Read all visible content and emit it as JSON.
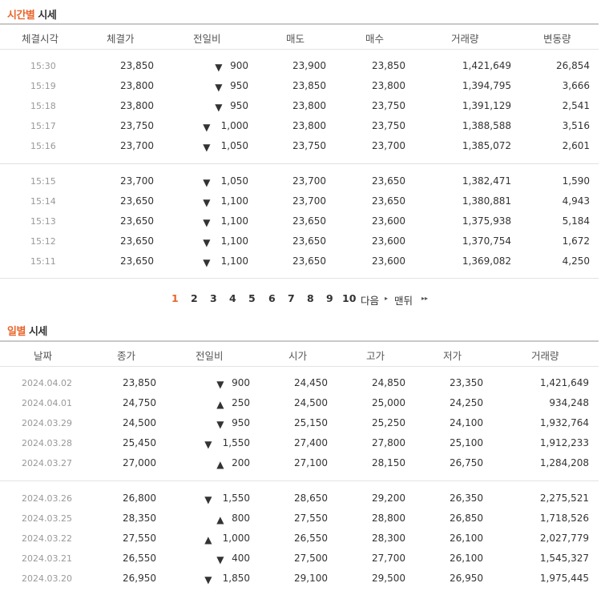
{
  "time_section": {
    "title_accent": "시간별",
    "title_rest": " 시세",
    "headers": [
      "체결시각",
      "체결가",
      "전일비",
      "매도",
      "매수",
      "거래량",
      "변동량"
    ],
    "groups": [
      [
        {
          "time": "15:30",
          "price": "23,850",
          "dir": "down",
          "change": "900",
          "sell": "23,900",
          "buy": "23,850",
          "volume": "1,421,649",
          "delta": "26,854"
        },
        {
          "time": "15:19",
          "price": "23,800",
          "dir": "down",
          "change": "950",
          "sell": "23,850",
          "buy": "23,800",
          "volume": "1,394,795",
          "delta": "3,666"
        },
        {
          "time": "15:18",
          "price": "23,800",
          "dir": "down",
          "change": "950",
          "sell": "23,800",
          "buy": "23,750",
          "volume": "1,391,129",
          "delta": "2,541"
        },
        {
          "time": "15:17",
          "price": "23,750",
          "dir": "down",
          "change": "1,000",
          "sell": "23,800",
          "buy": "23,750",
          "volume": "1,388,588",
          "delta": "3,516"
        },
        {
          "time": "15:16",
          "price": "23,700",
          "dir": "down",
          "change": "1,050",
          "sell": "23,750",
          "buy": "23,700",
          "volume": "1,385,072",
          "delta": "2,601"
        }
      ],
      [
        {
          "time": "15:15",
          "price": "23,700",
          "dir": "down",
          "change": "1,050",
          "sell": "23,700",
          "buy": "23,650",
          "volume": "1,382,471",
          "delta": "1,590"
        },
        {
          "time": "15:14",
          "price": "23,650",
          "dir": "down",
          "change": "1,100",
          "sell": "23,700",
          "buy": "23,650",
          "volume": "1,380,881",
          "delta": "4,943"
        },
        {
          "time": "15:13",
          "price": "23,650",
          "dir": "down",
          "change": "1,100",
          "sell": "23,650",
          "buy": "23,600",
          "volume": "1,375,938",
          "delta": "5,184"
        },
        {
          "time": "15:12",
          "price": "23,650",
          "dir": "down",
          "change": "1,100",
          "sell": "23,650",
          "buy": "23,600",
          "volume": "1,370,754",
          "delta": "1,672"
        },
        {
          "time": "15:11",
          "price": "23,650",
          "dir": "down",
          "change": "1,100",
          "sell": "23,650",
          "buy": "23,600",
          "volume": "1,369,082",
          "delta": "4,250"
        }
      ]
    ]
  },
  "pagination": {
    "pages": [
      "1",
      "2",
      "3",
      "4",
      "5",
      "6",
      "7",
      "8",
      "9",
      "10"
    ],
    "current": "1",
    "next_label": "다음",
    "last_label": "맨뒤"
  },
  "daily_section": {
    "title_accent": "일별",
    "title_rest": " 시세",
    "headers": [
      "날짜",
      "종가",
      "전일비",
      "시가",
      "고가",
      "저가",
      "거래량"
    ],
    "groups": [
      [
        {
          "date": "2024.04.02",
          "close": "23,850",
          "dir": "down",
          "change": "900",
          "open": "24,450",
          "high": "24,850",
          "low": "23,350",
          "volume": "1,421,649"
        },
        {
          "date": "2024.04.01",
          "close": "24,750",
          "dir": "up",
          "change": "250",
          "open": "24,500",
          "high": "25,000",
          "low": "24,250",
          "volume": "934,248"
        },
        {
          "date": "2024.03.29",
          "close": "24,500",
          "dir": "down",
          "change": "950",
          "open": "25,150",
          "high": "25,250",
          "low": "24,100",
          "volume": "1,932,764"
        },
        {
          "date": "2024.03.28",
          "close": "25,450",
          "dir": "down",
          "change": "1,550",
          "open": "27,400",
          "high": "27,800",
          "low": "25,100",
          "volume": "1,912,233"
        },
        {
          "date": "2024.03.27",
          "close": "27,000",
          "dir": "up",
          "change": "200",
          "open": "27,100",
          "high": "28,150",
          "low": "26,750",
          "volume": "1,284,208"
        }
      ],
      [
        {
          "date": "2024.03.26",
          "close": "26,800",
          "dir": "down",
          "change": "1,550",
          "open": "28,650",
          "high": "29,200",
          "low": "26,350",
          "volume": "2,275,521"
        },
        {
          "date": "2024.03.25",
          "close": "28,350",
          "dir": "up",
          "change": "800",
          "open": "27,550",
          "high": "28,800",
          "low": "26,850",
          "volume": "1,718,526"
        },
        {
          "date": "2024.03.22",
          "close": "27,550",
          "dir": "up",
          "change": "1,000",
          "open": "26,550",
          "high": "28,300",
          "low": "26,100",
          "volume": "2,027,779"
        },
        {
          "date": "2024.03.21",
          "close": "26,550",
          "dir": "down",
          "change": "400",
          "open": "27,500",
          "high": "27,700",
          "low": "26,100",
          "volume": "1,545,327"
        },
        {
          "date": "2024.03.20",
          "close": "26,950",
          "dir": "down",
          "change": "1,850",
          "open": "29,100",
          "high": "29,500",
          "low": "26,950",
          "volume": "1,975,445"
        }
      ]
    ]
  },
  "icons": {
    "down": "▼",
    "up": "▲",
    "next": "▸",
    "last": "▸▸"
  },
  "colors": {
    "accent": "#e8652b",
    "down": "#1c6bd1",
    "up": "#d3191c"
  }
}
